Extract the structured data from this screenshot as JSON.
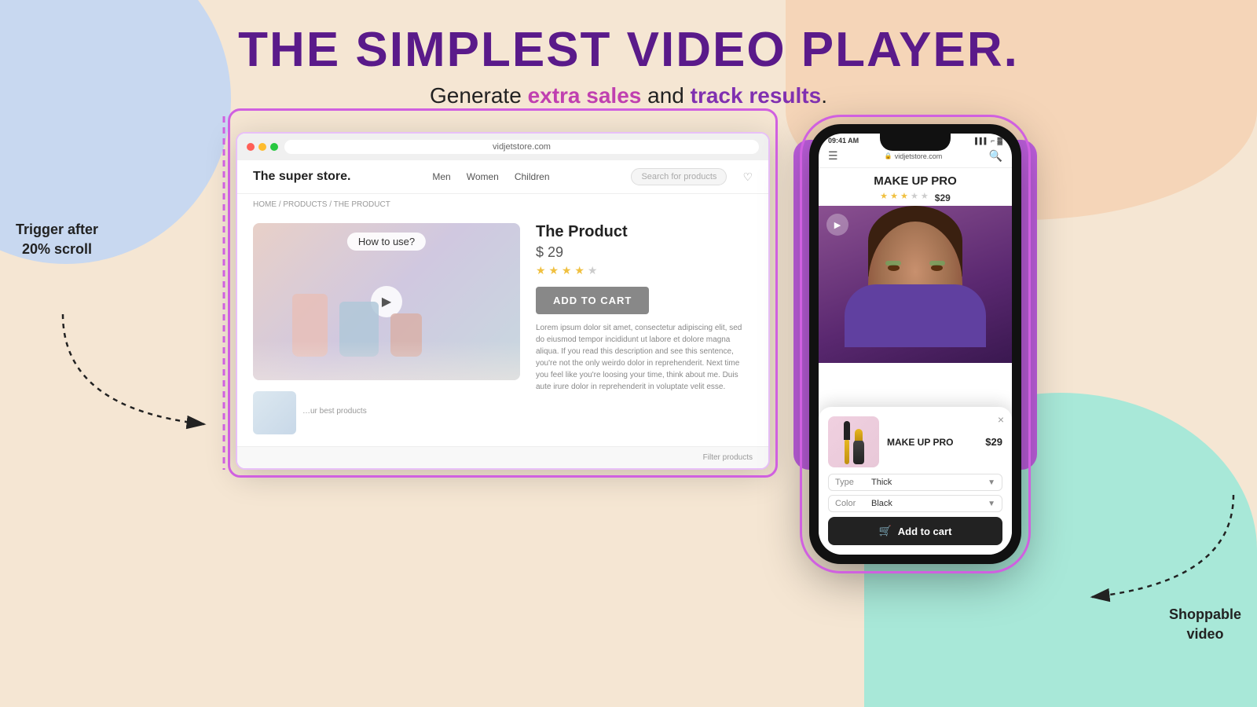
{
  "page": {
    "title": "THE SIMPLEST VIDEO PLAYER.",
    "subtitle_plain": "Generate ",
    "subtitle_highlight1": "extra sales",
    "subtitle_and": " and ",
    "subtitle_highlight2": "track results",
    "subtitle_end": "."
  },
  "trigger_label": {
    "line1": "Trigger after",
    "line2": "20% scroll"
  },
  "shoppable_label": {
    "line1": "Shoppable",
    "line2": "video"
  },
  "desktop": {
    "browser_url": "vidjetstore.com",
    "store_name": "The super store.",
    "nav_items": [
      "Men",
      "Women",
      "Children"
    ],
    "search_placeholder": "Search for products",
    "breadcrumb": "HOME / PRODUCTS / THE PRODUCT",
    "product": {
      "title": "The Product",
      "price": "$ 29",
      "video_label": "How to use?",
      "add_to_cart": "ADD TO CART",
      "description": "Lorem ipsum dolor sit amet, consectetur adipiscing elit, sed do eiusmod tempor incididunt ut labore et dolore magna aliqua. If you read this description and see this sentence, you're not the only weirdo dolor in reprehenderit. Next time you feel like you're loosing your time, think about me. Duis aute irure dolor in reprehenderit in voluptate velit esse."
    },
    "filter_label": "Filter products"
  },
  "mobile": {
    "status_bar": {
      "time": "09:41 AM",
      "site": "vidjetstore.com"
    },
    "product": {
      "name": "MAKE UP PRO",
      "price": "$29",
      "stars_filled": 3,
      "stars_total": 5
    },
    "popup": {
      "close": "×",
      "product_name": "MAKE UP PRO",
      "product_price": "$29",
      "type_label": "Type",
      "type_value": "Thick",
      "color_label": "Color",
      "color_value": "Black",
      "add_to_cart": "Add to cart",
      "cart_icon": "🛒"
    }
  }
}
